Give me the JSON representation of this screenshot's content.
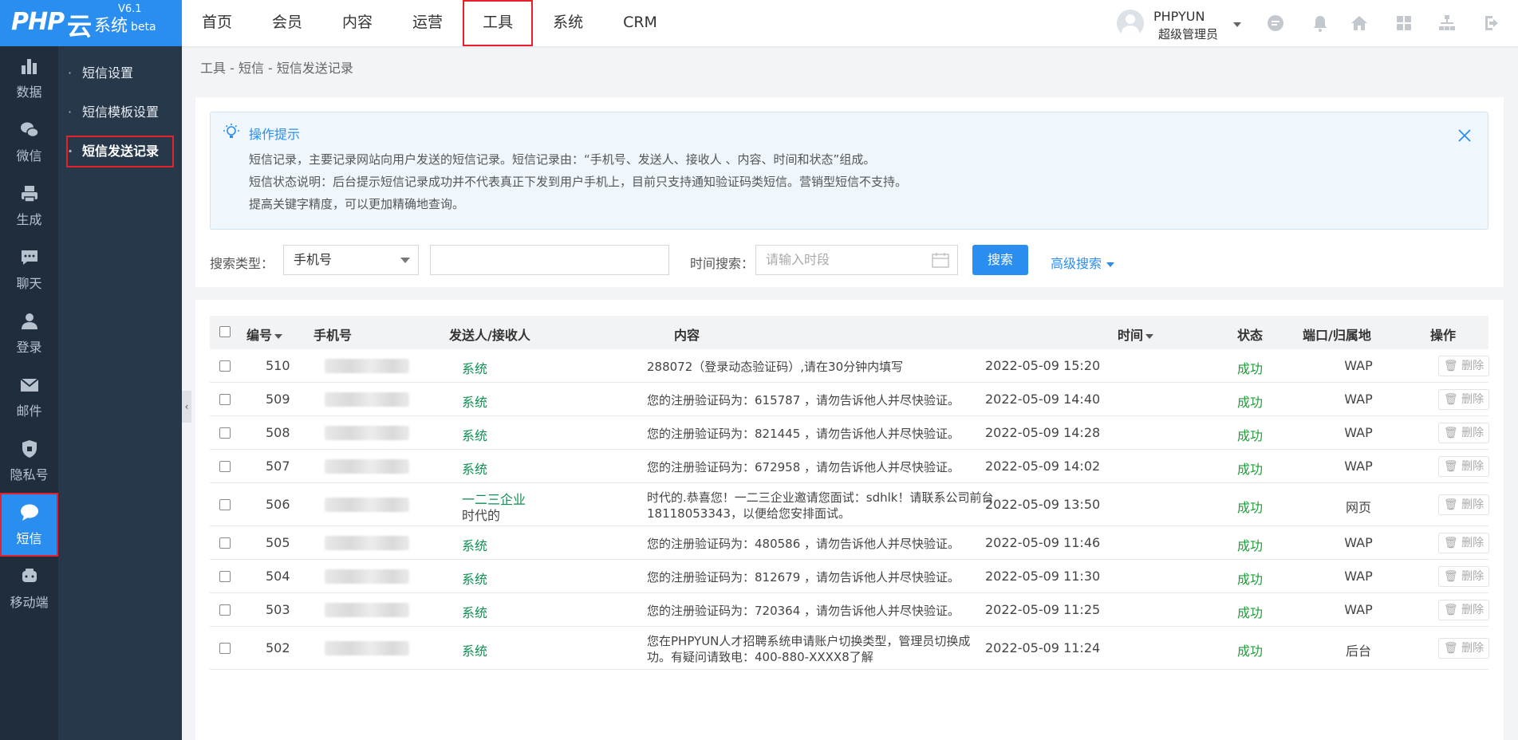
{
  "app": {
    "logo_text": "PHP",
    "logo_yun": "云",
    "logo_sys": "系统",
    "version": "V6.1",
    "beta": "beta"
  },
  "topnav": [
    {
      "label": "首页"
    },
    {
      "label": "会员"
    },
    {
      "label": "内容"
    },
    {
      "label": "运营"
    },
    {
      "label": "工具",
      "active": true
    },
    {
      "label": "系统"
    },
    {
      "label": "CRM"
    }
  ],
  "user": {
    "name": "PHPYUN",
    "role": "超级管理员"
  },
  "top_icons": [
    "chat-icon",
    "bell-icon",
    "home-icon",
    "grid-icon",
    "sitemap-icon",
    "logout-icon"
  ],
  "sidebar": [
    {
      "label": "数据",
      "icon": "bar-chart-icon"
    },
    {
      "label": "微信",
      "icon": "wechat-icon"
    },
    {
      "label": "生成",
      "icon": "printer-icon"
    },
    {
      "label": "聊天",
      "icon": "message-icon"
    },
    {
      "label": "登录",
      "icon": "user-icon"
    },
    {
      "label": "邮件",
      "icon": "mail-icon"
    },
    {
      "label": "隐私号",
      "icon": "shield-icon"
    },
    {
      "label": "短信",
      "icon": "sms-bubble-icon",
      "active": true
    },
    {
      "label": "移动端",
      "icon": "mobile-icon"
    }
  ],
  "subnav": [
    {
      "label": "短信设置"
    },
    {
      "label": "短信模板设置"
    },
    {
      "label": "短信发送记录",
      "active": true
    }
  ],
  "breadcrumb": "工具 - 短信 - 短信发送记录",
  "tip": {
    "title": "操作提示",
    "lines": [
      "短信记录，主要记录网站向用户发送的短信记录。短信记录由：“手机号、发送人、接收人 、内容、时间和状态”组成。",
      "短信状态说明：后台提示短信记录成功并不代表真正下发到用户手机上，目前只支持通知验证码类短信。营销型短信不支持。",
      "提高关键字精度，可以更加精确地查询。"
    ]
  },
  "search": {
    "type_label": "搜索类型：",
    "type_value": "手机号",
    "keyword_value": "",
    "time_label": "时间搜索：",
    "time_placeholder": "请输入时段",
    "button": "搜索",
    "advanced": "高级搜索"
  },
  "table": {
    "columns": [
      "编号",
      "手机号",
      "发送人/接收人",
      "内容",
      "时间",
      "状态",
      "端口/归属地",
      "操作"
    ],
    "delete_label": "删除",
    "rows": [
      {
        "id": "510",
        "sender": "系统",
        "receiver": "",
        "content": [
          "288072（登录动态验证码）,请在30分钟内填写"
        ],
        "time": "2022-05-09 15:20",
        "status": "成功",
        "port": "WAP"
      },
      {
        "id": "509",
        "sender": "系统",
        "receiver": "",
        "content": [
          "您的注册验证码为：615787 ，请勿告诉他人并尽快验证。"
        ],
        "time": "2022-05-09 14:40",
        "status": "成功",
        "port": "WAP"
      },
      {
        "id": "508",
        "sender": "系统",
        "receiver": "",
        "content": [
          "您的注册验证码为：821445 ，请勿告诉他人并尽快验证。"
        ],
        "time": "2022-05-09 14:28",
        "status": "成功",
        "port": "WAP"
      },
      {
        "id": "507",
        "sender": "系统",
        "receiver": "",
        "content": [
          "您的注册验证码为：672958 ，请勿告诉他人并尽快验证。"
        ],
        "time": "2022-05-09 14:02",
        "status": "成功",
        "port": "WAP"
      },
      {
        "id": "506",
        "sender": "一二三企业",
        "receiver": "时代的",
        "content": [
          "时代的.恭喜您！一二三企业邀请您面试：sdhlk！请联系公司前台",
          "18118053343，以便给您安排面试。"
        ],
        "time": "2022-05-09 13:50",
        "status": "成功",
        "port": "网页"
      },
      {
        "id": "505",
        "sender": "系统",
        "receiver": "",
        "content": [
          "您的注册验证码为：480586 ，请勿告诉他人并尽快验证。"
        ],
        "time": "2022-05-09 11:46",
        "status": "成功",
        "port": "WAP"
      },
      {
        "id": "504",
        "sender": "系统",
        "receiver": "",
        "content": [
          "您的注册验证码为：812679 ，请勿告诉他人并尽快验证。"
        ],
        "time": "2022-05-09 11:30",
        "status": "成功",
        "port": "WAP"
      },
      {
        "id": "503",
        "sender": "系统",
        "receiver": "",
        "content": [
          "您的注册验证码为：720364 ，请勿告诉他人并尽快验证。"
        ],
        "time": "2022-05-09 11:25",
        "status": "成功",
        "port": "WAP"
      },
      {
        "id": "502",
        "sender": "系统",
        "receiver": "",
        "content": [
          "您在PHPYUN人才招聘系统申请账户切换类型，管理员切换成",
          "功。有疑问请致电：400-880-XXXX8了解"
        ],
        "time": "2022-05-09 11:24",
        "status": "成功",
        "port": "后台"
      }
    ]
  }
}
